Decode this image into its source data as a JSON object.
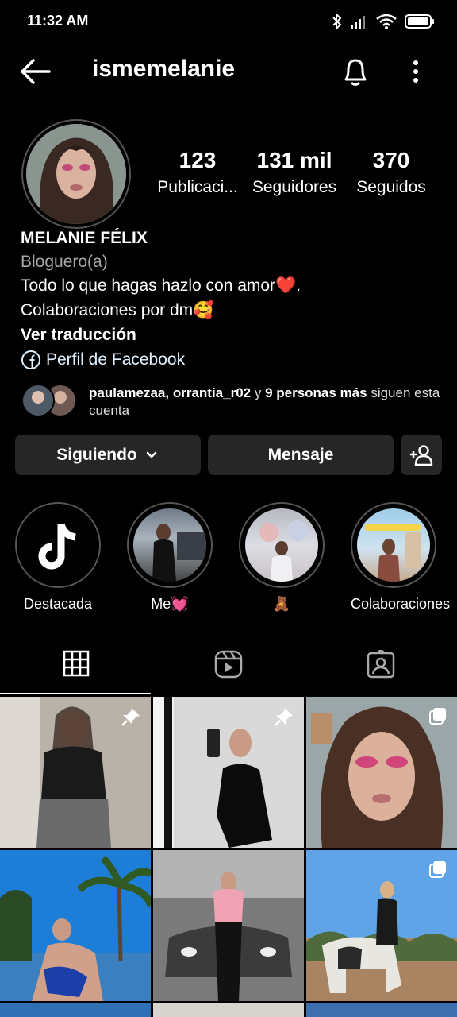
{
  "status_bar": {
    "time": "11:32 AM"
  },
  "header": {
    "username": "ismemelanie"
  },
  "stats": [
    {
      "number": "123",
      "label": "Publicaci..."
    },
    {
      "number": "131 mil",
      "label": "Seguidores"
    },
    {
      "number": "370",
      "label": "Seguidos"
    }
  ],
  "profile": {
    "name": "MELANIE FÉLIX",
    "category": "Bloguero(a)",
    "bio_line1": "Todo lo que hagas hazlo con amor❤️.",
    "bio_line2": "Colaboraciones por dm🥰",
    "translate": "Ver traducción",
    "facebook": "Perfil de Facebook"
  },
  "followed_by": {
    "user1": "paulamezaa",
    "sep": ", ",
    "user2": "orrantia_r02",
    "and": " y ",
    "others": "9 personas más",
    "suffix": " siguen esta cuenta"
  },
  "buttons": {
    "following": "Siguiendo",
    "message": "Mensaje"
  },
  "highlights": [
    {
      "label": "Destacada"
    },
    {
      "label": "Me💓"
    },
    {
      "label": "🧸"
    },
    {
      "label": "Colaboraciones"
    }
  ],
  "colors": {
    "background": "#000000",
    "button": "#262626",
    "muted": "#a8a8a8",
    "link": "#e0f1ff"
  }
}
